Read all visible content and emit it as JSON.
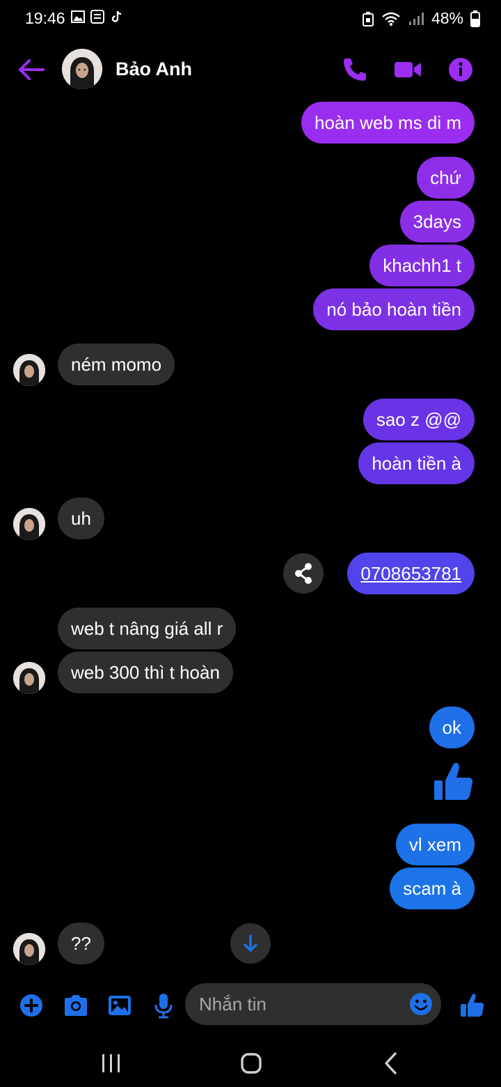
{
  "status_bar": {
    "time": "19:46",
    "battery": "48%"
  },
  "header": {
    "contact_name": "Bảo Anh"
  },
  "colors": {
    "accent": "#9B2EF0",
    "bubble_purple": "#8A2BE2",
    "bubble_blue": "#1F70E8",
    "bubble_indigo": "#5A3CF0",
    "incoming": "#2F2F2F"
  },
  "messages": [
    {
      "side": "out",
      "text": "hoàn web ms di m"
    },
    {
      "side": "out",
      "text": "chứ"
    },
    {
      "side": "out",
      "text": "3days"
    },
    {
      "side": "out",
      "text": "khachh1 t"
    },
    {
      "side": "out",
      "text": "nó bảo hoàn tiền"
    },
    {
      "side": "in",
      "text": "ném momo"
    },
    {
      "side": "out",
      "text": "sao z @@"
    },
    {
      "side": "out",
      "text": "hoàn tiền à"
    },
    {
      "side": "in",
      "text": "uh"
    },
    {
      "side": "out",
      "text": "0708653781"
    },
    {
      "side": "in",
      "text": "web t nâng giá all r"
    },
    {
      "side": "in",
      "text": "web 300 thì t hoàn"
    },
    {
      "side": "out",
      "text": "ok"
    },
    {
      "side": "out",
      "text": "vl xem"
    },
    {
      "side": "out",
      "text": "scam à"
    },
    {
      "side": "in",
      "text": "??"
    }
  ],
  "composer": {
    "placeholder": "Nhắn tin"
  },
  "icons": [
    "back-arrow-icon",
    "phone-icon",
    "video-icon",
    "info-icon",
    "share-icon",
    "thumbs-up-icon",
    "arrow-down-icon",
    "plus-icon",
    "camera-icon",
    "gallery-icon",
    "microphone-icon",
    "emoji-icon",
    "recent-apps-icon",
    "home-icon",
    "back-nav-icon"
  ]
}
